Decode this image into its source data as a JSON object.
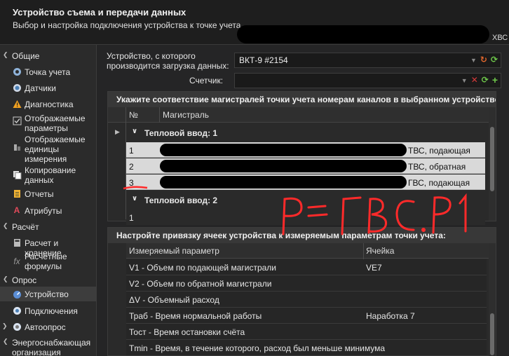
{
  "header": {
    "title": "Устройство съема и передачи данных",
    "subtitle": "Выбор и настройка подключения устройства к точке учета",
    "extra": "ХВС"
  },
  "sidebar": {
    "sections": [
      {
        "label": "Общие"
      },
      {
        "label": "Расчёт"
      },
      {
        "label": "Опрос"
      },
      {
        "label": "Энергоснабжающая организация"
      }
    ],
    "items": [
      {
        "label": "Точка учета",
        "icon": "location-pin-icon"
      },
      {
        "label": "Датчики",
        "icon": "sensor-icon"
      },
      {
        "label": "Диагностика",
        "icon": "warning-icon"
      },
      {
        "label": "Отображаемые параметры",
        "icon": "checklist-icon"
      },
      {
        "label": "Отображаемые единицы измерения",
        "icon": "scale-icon"
      },
      {
        "label": "Копирование данных",
        "icon": "copy-icon"
      },
      {
        "label": "Отчеты",
        "icon": "report-icon"
      },
      {
        "label": "Атрибуты",
        "icon": "attribute-icon"
      },
      {
        "label": "Расчет и хранение",
        "icon": "calculator-icon"
      },
      {
        "label": "Расчётные формулы",
        "icon": "formula-icon"
      },
      {
        "label": "Устройство",
        "icon": "device-icon"
      },
      {
        "label": "Подключения",
        "icon": "connection-icon"
      },
      {
        "label": "Автоопрос",
        "icon": "auto-poll-icon"
      }
    ]
  },
  "form": {
    "device_label": "Устройство, с которого производится загрузка данных:",
    "device_value": "ВКТ-9 #2154",
    "meter_label": "Счетчик:",
    "meter_value": ""
  },
  "mapping_panel": {
    "title": "Укажите соответствие магистралей точки учета номерам каналов в выбранном устройстве",
    "columns": [
      "№",
      "Магистраль"
    ],
    "groups": [
      {
        "label": "Тепловой ввод: 1",
        "rows": [
          {
            "num": "1",
            "line": "ТВС, подающая"
          },
          {
            "num": "2",
            "line": "ТВС, обратная"
          },
          {
            "num": "3",
            "line": "ГВС, подающая"
          }
        ]
      },
      {
        "label": "Тепловой ввод: 2",
        "rows": [
          {
            "num": "1",
            "line": ""
          }
        ]
      }
    ]
  },
  "params_panel": {
    "title": "Настройте привязку ячеек устройства к измеряемым параметрам точки учета:",
    "columns": [
      "Измеряемый параметр",
      "Ячейка"
    ],
    "rows": [
      {
        "param": "V1 - Объем по подающей магистрали",
        "cell": "VE7"
      },
      {
        "param": "V2 - Объем по обратной магистрали",
        "cell": ""
      },
      {
        "param": "ΔV - Объемный расход",
        "cell": ""
      },
      {
        "param": "Траб - Время нормальной работы",
        "cell": "Наработка 7"
      },
      {
        "param": "Тост - Время остановки счёта",
        "cell": ""
      },
      {
        "param": "Tmin - Время, в течение которого, расход был меньше минимума",
        "cell": ""
      }
    ]
  },
  "annotation": {
    "text": "P = ГВС.P1",
    "color": "#ff2a2a"
  }
}
